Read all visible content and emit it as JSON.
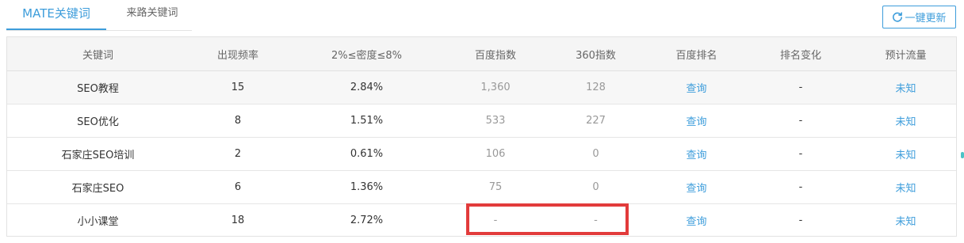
{
  "tabs": [
    {
      "label": "MATE关键词",
      "active": true
    },
    {
      "label": "来路关键词",
      "active": false
    }
  ],
  "toolbar": {
    "refresh_label": "一键更新",
    "refresh_icon": "refresh-icon"
  },
  "table": {
    "columns": [
      "关键词",
      "出现频率",
      "2%≤密度≤8%",
      "百度指数",
      "360指数",
      "百度排名",
      "排名变化",
      "预计流量"
    ],
    "rows": [
      {
        "keyword": "SEO教程",
        "frequency": "15",
        "density": "2.84%",
        "baidu_index": "1,360",
        "index_360": "128",
        "baidu_rank": "查询",
        "rank_change": "-",
        "traffic": "未知"
      },
      {
        "keyword": "SEO优化",
        "frequency": "8",
        "density": "1.51%",
        "baidu_index": "533",
        "index_360": "227",
        "baidu_rank": "查询",
        "rank_change": "-",
        "traffic": "未知"
      },
      {
        "keyword": "石家庄SEO培训",
        "frequency": "2",
        "density": "0.61%",
        "baidu_index": "106",
        "index_360": "0",
        "baidu_rank": "查询",
        "rank_change": "-",
        "traffic": "未知"
      },
      {
        "keyword": "石家庄SEO",
        "frequency": "6",
        "density": "1.36%",
        "baidu_index": "75",
        "index_360": "0",
        "baidu_rank": "查询",
        "rank_change": "-",
        "traffic": "未知"
      },
      {
        "keyword": "小小课堂",
        "frequency": "18",
        "density": "2.72%",
        "baidu_index": "-",
        "index_360": "-",
        "baidu_rank": "查询",
        "rank_change": "-",
        "traffic": "未知"
      }
    ]
  },
  "colors": {
    "accent": "#3d9ddb",
    "highlight": "#e23b3b",
    "header_bg": "#f5f5f5",
    "alt_row_bg": "#f7f7f7"
  }
}
